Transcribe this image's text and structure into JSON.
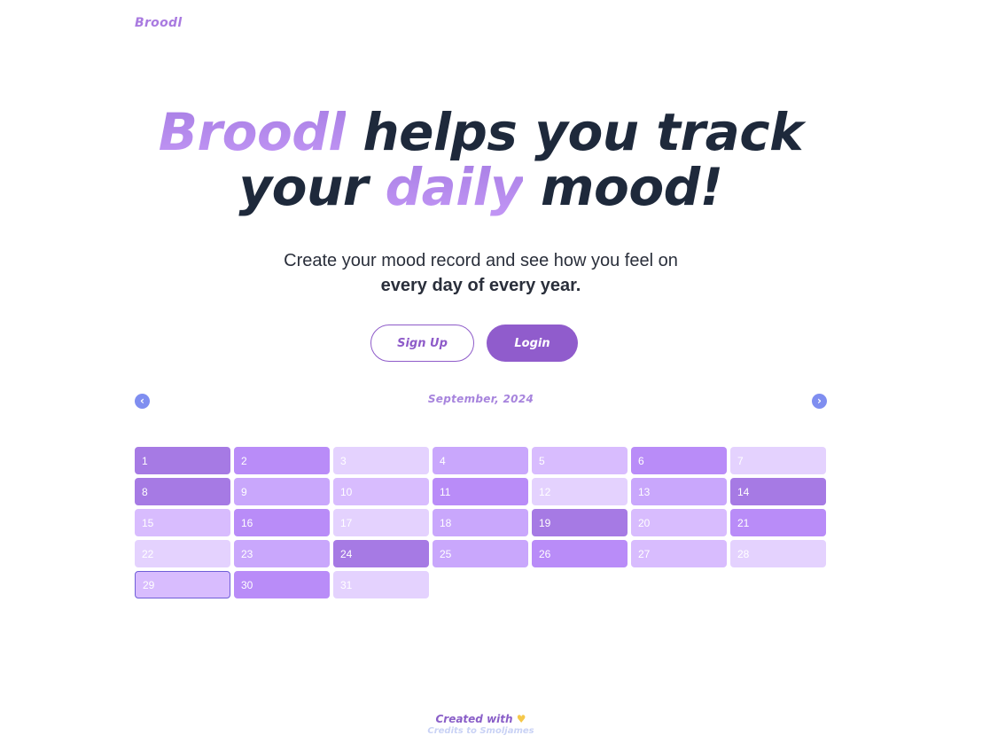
{
  "brand": {
    "logo": "Broodl"
  },
  "hero": {
    "brand_word": "Broodl",
    "line1_rest": " helps you track",
    "line2_start": "your ",
    "highlight": "daily",
    "line2_end": " mood!"
  },
  "subtitle": {
    "line1": "Create your mood record and see how you feel on",
    "line2": "every day of every year."
  },
  "buttons": {
    "signup": "Sign Up",
    "login": "Login"
  },
  "calendar": {
    "month_label": "September, 2024",
    "selected_day": 29,
    "days": [
      {
        "label": "1",
        "color": "#a67ae4"
      },
      {
        "label": "2",
        "color": "#b98cf8"
      },
      {
        "label": "3",
        "color": "#e4d2fe"
      },
      {
        "label": "4",
        "color": "#c9a7fc"
      },
      {
        "label": "5",
        "color": "#d8bcfe"
      },
      {
        "label": "6",
        "color": "#b98cf8"
      },
      {
        "label": "7",
        "color": "#e4d2fe"
      },
      {
        "label": "8",
        "color": "#a67ae4"
      },
      {
        "label": "9",
        "color": "#c9a7fc"
      },
      {
        "label": "10",
        "color": "#d8bcfe"
      },
      {
        "label": "11",
        "color": "#b98cf8"
      },
      {
        "label": "12",
        "color": "#e4d2fe"
      },
      {
        "label": "13",
        "color": "#c9a7fc"
      },
      {
        "label": "14",
        "color": "#a67ae4"
      },
      {
        "label": "15",
        "color": "#d8bcfe"
      },
      {
        "label": "16",
        "color": "#b98cf8"
      },
      {
        "label": "17",
        "color": "#e4d2fe"
      },
      {
        "label": "18",
        "color": "#c9a7fc"
      },
      {
        "label": "19",
        "color": "#a67ae4"
      },
      {
        "label": "20",
        "color": "#d8bcfe"
      },
      {
        "label": "21",
        "color": "#b98cf8"
      },
      {
        "label": "22",
        "color": "#e4d2fe"
      },
      {
        "label": "23",
        "color": "#c9a7fc"
      },
      {
        "label": "24",
        "color": "#a67ae4"
      },
      {
        "label": "25",
        "color": "#c9a7fc"
      },
      {
        "label": "26",
        "color": "#b98cf8"
      },
      {
        "label": "27",
        "color": "#d8bcfe"
      },
      {
        "label": "28",
        "color": "#e4d2fe"
      },
      {
        "label": "29",
        "color": "#d8bcfe"
      },
      {
        "label": "30",
        "color": "#b98cf8"
      },
      {
        "label": "31",
        "color": "#e4d2fe"
      }
    ]
  },
  "footer": {
    "created_with": "Created with",
    "heart": "♥",
    "credits": "Credits to Smoljames"
  },
  "icons": {
    "prev": "chevron-left-icon",
    "next": "chevron-right-icon"
  }
}
